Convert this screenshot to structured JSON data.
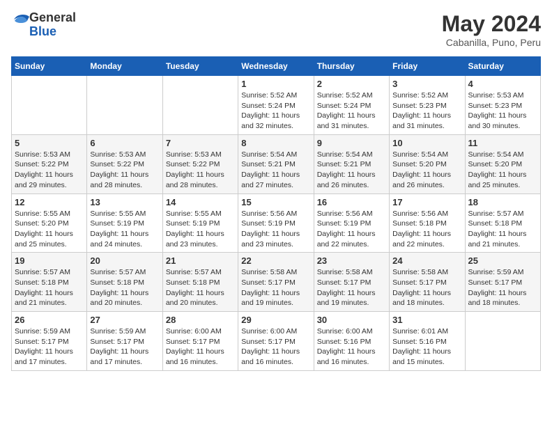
{
  "header": {
    "logo": {
      "general": "General",
      "blue": "Blue"
    },
    "title": "May 2024",
    "location": "Cabanilla, Puno, Peru"
  },
  "weekdays": [
    "Sunday",
    "Monday",
    "Tuesday",
    "Wednesday",
    "Thursday",
    "Friday",
    "Saturday"
  ],
  "weeks": [
    [
      {
        "day": "",
        "info": ""
      },
      {
        "day": "",
        "info": ""
      },
      {
        "day": "",
        "info": ""
      },
      {
        "day": "1",
        "info": "Sunrise: 5:52 AM\nSunset: 5:24 PM\nDaylight: 11 hours\nand 32 minutes."
      },
      {
        "day": "2",
        "info": "Sunrise: 5:52 AM\nSunset: 5:24 PM\nDaylight: 11 hours\nand 31 minutes."
      },
      {
        "day": "3",
        "info": "Sunrise: 5:52 AM\nSunset: 5:23 PM\nDaylight: 11 hours\nand 31 minutes."
      },
      {
        "day": "4",
        "info": "Sunrise: 5:53 AM\nSunset: 5:23 PM\nDaylight: 11 hours\nand 30 minutes."
      }
    ],
    [
      {
        "day": "5",
        "info": "Sunrise: 5:53 AM\nSunset: 5:22 PM\nDaylight: 11 hours\nand 29 minutes."
      },
      {
        "day": "6",
        "info": "Sunrise: 5:53 AM\nSunset: 5:22 PM\nDaylight: 11 hours\nand 28 minutes."
      },
      {
        "day": "7",
        "info": "Sunrise: 5:53 AM\nSunset: 5:22 PM\nDaylight: 11 hours\nand 28 minutes."
      },
      {
        "day": "8",
        "info": "Sunrise: 5:54 AM\nSunset: 5:21 PM\nDaylight: 11 hours\nand 27 minutes."
      },
      {
        "day": "9",
        "info": "Sunrise: 5:54 AM\nSunset: 5:21 PM\nDaylight: 11 hours\nand 26 minutes."
      },
      {
        "day": "10",
        "info": "Sunrise: 5:54 AM\nSunset: 5:20 PM\nDaylight: 11 hours\nand 26 minutes."
      },
      {
        "day": "11",
        "info": "Sunrise: 5:54 AM\nSunset: 5:20 PM\nDaylight: 11 hours\nand 25 minutes."
      }
    ],
    [
      {
        "day": "12",
        "info": "Sunrise: 5:55 AM\nSunset: 5:20 PM\nDaylight: 11 hours\nand 25 minutes."
      },
      {
        "day": "13",
        "info": "Sunrise: 5:55 AM\nSunset: 5:19 PM\nDaylight: 11 hours\nand 24 minutes."
      },
      {
        "day": "14",
        "info": "Sunrise: 5:55 AM\nSunset: 5:19 PM\nDaylight: 11 hours\nand 23 minutes."
      },
      {
        "day": "15",
        "info": "Sunrise: 5:56 AM\nSunset: 5:19 PM\nDaylight: 11 hours\nand 23 minutes."
      },
      {
        "day": "16",
        "info": "Sunrise: 5:56 AM\nSunset: 5:19 PM\nDaylight: 11 hours\nand 22 minutes."
      },
      {
        "day": "17",
        "info": "Sunrise: 5:56 AM\nSunset: 5:18 PM\nDaylight: 11 hours\nand 22 minutes."
      },
      {
        "day": "18",
        "info": "Sunrise: 5:57 AM\nSunset: 5:18 PM\nDaylight: 11 hours\nand 21 minutes."
      }
    ],
    [
      {
        "day": "19",
        "info": "Sunrise: 5:57 AM\nSunset: 5:18 PM\nDaylight: 11 hours\nand 21 minutes."
      },
      {
        "day": "20",
        "info": "Sunrise: 5:57 AM\nSunset: 5:18 PM\nDaylight: 11 hours\nand 20 minutes."
      },
      {
        "day": "21",
        "info": "Sunrise: 5:57 AM\nSunset: 5:18 PM\nDaylight: 11 hours\nand 20 minutes."
      },
      {
        "day": "22",
        "info": "Sunrise: 5:58 AM\nSunset: 5:17 PM\nDaylight: 11 hours\nand 19 minutes."
      },
      {
        "day": "23",
        "info": "Sunrise: 5:58 AM\nSunset: 5:17 PM\nDaylight: 11 hours\nand 19 minutes."
      },
      {
        "day": "24",
        "info": "Sunrise: 5:58 AM\nSunset: 5:17 PM\nDaylight: 11 hours\nand 18 minutes."
      },
      {
        "day": "25",
        "info": "Sunrise: 5:59 AM\nSunset: 5:17 PM\nDaylight: 11 hours\nand 18 minutes."
      }
    ],
    [
      {
        "day": "26",
        "info": "Sunrise: 5:59 AM\nSunset: 5:17 PM\nDaylight: 11 hours\nand 17 minutes."
      },
      {
        "day": "27",
        "info": "Sunrise: 5:59 AM\nSunset: 5:17 PM\nDaylight: 11 hours\nand 17 minutes."
      },
      {
        "day": "28",
        "info": "Sunrise: 6:00 AM\nSunset: 5:17 PM\nDaylight: 11 hours\nand 16 minutes."
      },
      {
        "day": "29",
        "info": "Sunrise: 6:00 AM\nSunset: 5:17 PM\nDaylight: 11 hours\nand 16 minutes."
      },
      {
        "day": "30",
        "info": "Sunrise: 6:00 AM\nSunset: 5:16 PM\nDaylight: 11 hours\nand 16 minutes."
      },
      {
        "day": "31",
        "info": "Sunrise: 6:01 AM\nSunset: 5:16 PM\nDaylight: 11 hours\nand 15 minutes."
      },
      {
        "day": "",
        "info": ""
      }
    ]
  ]
}
